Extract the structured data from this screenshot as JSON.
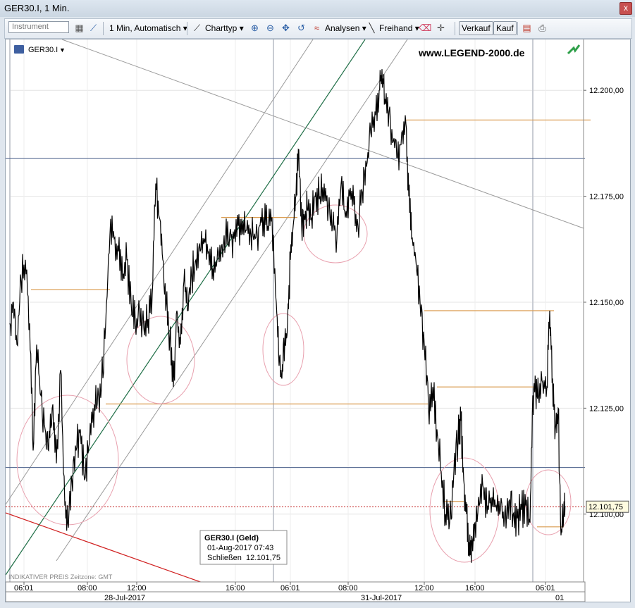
{
  "window": {
    "title": "GER30.I, 1 Min.",
    "close_label": "x"
  },
  "toolbar": {
    "instrument_placeholder": "Instrument",
    "interval_label": "1 Min, Automatisch",
    "charttype_label": "Charttyp",
    "analysis_label": "Analysen",
    "freehand_label": "Freihand",
    "sell_label": "Verkauf",
    "buy_label": "Kauf",
    "icons": [
      "table-icon",
      "compare-icon",
      "line-chart-icon",
      "zoom-in-icon",
      "zoom-out-icon",
      "move-icon",
      "undo-icon",
      "analysis-icon",
      "pencil-icon",
      "eraser-icon",
      "crosshair-icon",
      "chart-settings-icon",
      "print-icon"
    ]
  },
  "chart": {
    "symbol": "GER30.I",
    "watermark": "www.LEGEND-2000.de",
    "footer_left": "INDIKATIVER PREIS   Zeitzone: GMT",
    "last_price_label": "12.101,75",
    "tooltip": {
      "title": "GER30.I (Geld)",
      "datetime": "01-Aug-2017 07:43",
      "close_label": "Schließen",
      "close_value": "12.101,75"
    },
    "colors": {
      "price_line": "#000000",
      "orange_level": "#d99a4e",
      "blue_level": "#4a5f8a",
      "red_trend": "#d02020",
      "green_channel": "#1e6e46",
      "gray_channel": "#9a9a9a",
      "pink_circle": "#e8a0ae",
      "dotted_level": "#c02020"
    }
  },
  "chart_data": {
    "type": "line",
    "y_axis_labels": [
      "12.200,00",
      "12.175,00",
      "12.150,00",
      "12.125,00",
      "12.100,00"
    ],
    "y_ticks": [
      12200,
      12175,
      12150,
      12125,
      12100
    ],
    "ylim": [
      12084,
      12212
    ],
    "x_time_labels": [
      "06:01",
      "08:00",
      "12:00",
      "16:00",
      "06:01",
      "08:00",
      "12:00",
      "16:00",
      "06:01"
    ],
    "x_date_labels": [
      "28-Jul-2017",
      "31-Jul-2017",
      "01"
    ],
    "series": [
      {
        "points": [
          [
            0,
            12145
          ],
          [
            5,
            12150
          ],
          [
            10,
            12140
          ],
          [
            16,
            12155
          ],
          [
            22,
            12160
          ],
          [
            28,
            12145
          ],
          [
            33,
            12115
          ],
          [
            38,
            12140
          ],
          [
            44,
            12128
          ],
          [
            50,
            12120
          ],
          [
            55,
            12115
          ],
          [
            60,
            12125
          ],
          [
            66,
            12112
          ],
          [
            72,
            12134
          ],
          [
            78,
            12102
          ],
          [
            82,
            12098
          ],
          [
            88,
            12108
          ],
          [
            94,
            12115
          ],
          [
            100,
            12120
          ],
          [
            106,
            12108
          ],
          [
            112,
            12116
          ],
          [
            118,
            12125
          ],
          [
            124,
            12126
          ],
          [
            130,
            12130
          ],
          [
            136,
            12145
          ],
          [
            142,
            12166
          ],
          [
            148,
            12165
          ],
          [
            154,
            12162
          ],
          [
            160,
            12155
          ],
          [
            166,
            12160
          ],
          [
            172,
            12150
          ],
          [
            178,
            12145
          ],
          [
            184,
            12148
          ],
          [
            190,
            12144
          ],
          [
            196,
            12146
          ],
          [
            202,
            12152
          ],
          [
            207,
            12178
          ],
          [
            212,
            12170
          ],
          [
            217,
            12160
          ],
          [
            222,
            12150
          ],
          [
            227,
            12142
          ],
          [
            232,
            12130
          ],
          [
            237,
            12148
          ],
          [
            242,
            12140
          ],
          [
            247,
            12155
          ],
          [
            252,
            12148
          ],
          [
            258,
            12156
          ],
          [
            264,
            12160
          ],
          [
            270,
            12162
          ],
          [
            276,
            12165
          ],
          [
            282,
            12162
          ],
          [
            288,
            12158
          ],
          [
            294,
            12160
          ],
          [
            300,
            12163
          ],
          [
            306,
            12165
          ],
          [
            312,
            12166
          ],
          [
            318,
            12165
          ],
          [
            324,
            12168
          ],
          [
            330,
            12166
          ],
          [
            336,
            12167
          ],
          [
            342,
            12166
          ],
          [
            348,
            12165
          ],
          [
            354,
            12168
          ],
          [
            360,
            12170
          ],
          [
            366,
            12168
          ],
          [
            372,
            12170
          ],
          [
            378,
            12150
          ],
          [
            382,
            12135
          ],
          [
            386,
            12132
          ],
          [
            390,
            12140
          ],
          [
            394,
            12145
          ],
          [
            398,
            12160
          ],
          [
            402,
            12168
          ],
          [
            406,
            12175
          ],
          [
            410,
            12186
          ],
          [
            414,
            12168
          ],
          [
            418,
            12170
          ],
          [
            422,
            12172
          ],
          [
            428,
            12170
          ],
          [
            434,
            12176
          ],
          [
            440,
            12175
          ],
          [
            446,
            12178
          ],
          [
            452,
            12172
          ],
          [
            458,
            12168
          ],
          [
            464,
            12165
          ],
          [
            470,
            12178
          ],
          [
            476,
            12170
          ],
          [
            482,
            12175
          ],
          [
            488,
            12173
          ],
          [
            494,
            12168
          ],
          [
            500,
            12176
          ],
          [
            506,
            12182
          ],
          [
            512,
            12190
          ],
          [
            518,
            12195
          ],
          [
            524,
            12200
          ],
          [
            528,
            12205
          ],
          [
            532,
            12198
          ],
          [
            538,
            12195
          ],
          [
            544,
            12188
          ],
          [
            550,
            12184
          ],
          [
            556,
            12190
          ],
          [
            562,
            12192
          ],
          [
            566,
            12175
          ],
          [
            570,
            12165
          ],
          [
            576,
            12160
          ],
          [
            582,
            12150
          ],
          [
            588,
            12140
          ],
          [
            594,
            12125
          ],
          [
            600,
            12130
          ],
          [
            606,
            12120
          ],
          [
            612,
            12110
          ],
          [
            618,
            12100
          ],
          [
            624,
            12098
          ],
          [
            630,
            12110
          ],
          [
            636,
            12118
          ],
          [
            640,
            12122
          ],
          [
            644,
            12108
          ],
          [
            648,
            12100
          ],
          [
            652,
            12090
          ],
          [
            656,
            12094
          ],
          [
            660,
            12098
          ],
          [
            666,
            12102
          ],
          [
            672,
            12106
          ],
          [
            678,
            12102
          ],
          [
            684,
            12104
          ],
          [
            690,
            12102
          ],
          [
            696,
            12101
          ],
          [
            702,
            12100
          ],
          [
            708,
            12103
          ],
          [
            714,
            12100
          ],
          [
            720,
            12099
          ],
          [
            726,
            12101
          ],
          [
            732,
            12102
          ],
          [
            738,
            12098
          ],
          [
            742,
            12128
          ],
          [
            746,
            12130
          ],
          [
            750,
            12128
          ],
          [
            756,
            12131
          ],
          [
            762,
            12130
          ],
          [
            766,
            12148
          ],
          [
            770,
            12132
          ],
          [
            774,
            12120
          ],
          [
            778,
            12125
          ],
          [
            782,
            12095
          ],
          [
            786,
            12102
          ],
          [
            788,
            12101.75
          ]
        ]
      }
    ],
    "horizontal_levels": {
      "blue": [
        12184,
        12111
      ],
      "orange": [
        {
          "x0": 30,
          "x1": 142,
          "y": 12153
        },
        {
          "x0": 300,
          "x1": 408,
          "y": 12170
        },
        {
          "x0": 136,
          "x1": 594,
          "y": 12126
        },
        {
          "x0": 562,
          "x1": 824,
          "y": 12193
        },
        {
          "x0": 588,
          "x1": 772,
          "y": 12148
        },
        {
          "x0": 606,
          "x1": 748,
          "y": 12130
        },
        {
          "x0": 614,
          "x1": 644,
          "y": 12103
        },
        {
          "x0": 748,
          "x1": 786,
          "y": 12097
        }
      ],
      "dotted_last": 12101.75
    },
    "ylabel": "",
    "xlabel": "",
    "grid": true,
    "title": ""
  }
}
